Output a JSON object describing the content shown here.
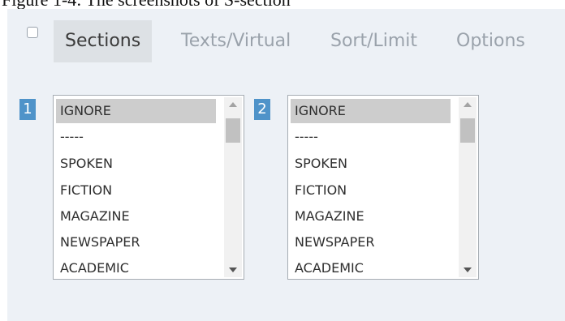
{
  "caption": "Figure 1-4: The screenshots of S-section",
  "tabs": [
    {
      "label": "Sections",
      "active": true
    },
    {
      "label": "Texts/Virtual",
      "active": false
    },
    {
      "label": "Sort/Limit",
      "active": false
    },
    {
      "label": "Options",
      "active": false
    }
  ],
  "lists": [
    {
      "number": "1",
      "options": [
        "IGNORE",
        "-----",
        "SPOKEN",
        "FICTION",
        "MAGAZINE",
        "NEWSPAPER",
        "ACADEMIC"
      ],
      "selected": "IGNORE"
    },
    {
      "number": "2",
      "options": [
        "IGNORE",
        "-----",
        "SPOKEN",
        "FICTION",
        "MAGAZINE",
        "NEWSPAPER",
        "ACADEMIC"
      ],
      "selected": "IGNORE"
    }
  ],
  "colors": {
    "panel_bg": "#edf1f6",
    "badge": "#4f93c9",
    "selected_option": "#cdcdcd",
    "active_tab_bg": "#dde1e5"
  }
}
